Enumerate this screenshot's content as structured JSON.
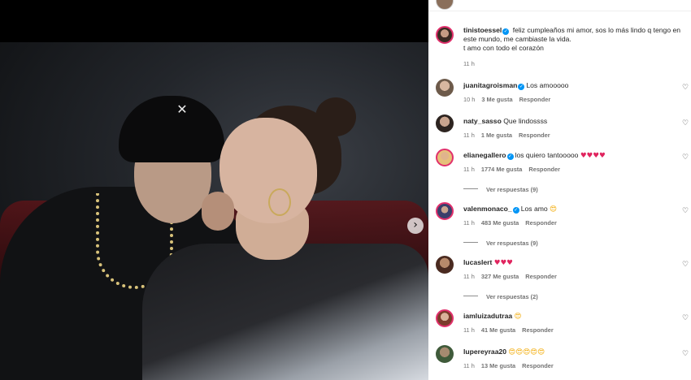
{
  "post": {
    "author": "tinistoessel",
    "caption_line1": "feliz cumpleaños mi amor, sos lo más lindo q tengo en este mundo, me cambiaste la vida.",
    "caption_line2": "t amo con todo el corazón",
    "time": "11 h"
  },
  "navigation": {
    "next_icon": "chevron-right-icon",
    "next_glyph": "›"
  },
  "icons": {
    "heart_glyph": "♡",
    "verified_glyph": "✓"
  },
  "colors": {
    "verified": "#0095f6",
    "panel_bg": "#ffffff",
    "text": "#262626",
    "muted": "#737373"
  },
  "comments": [
    {
      "user": "juanitagroisman",
      "verified": true,
      "text": "Los amooooo",
      "emoji": "",
      "time": "10 h",
      "likes": "3 Me gusta",
      "reply": "Responder",
      "replies": ""
    },
    {
      "user": "naty_sasso",
      "verified": false,
      "text": "Que lindossss",
      "emoji": "",
      "time": "11 h",
      "likes": "1 Me gusta",
      "reply": "Responder",
      "replies": ""
    },
    {
      "user": "elianegallero",
      "verified": true,
      "text": "los quiero tantooooo",
      "emoji": "♥♥♥♥",
      "time": "11 h",
      "likes": "1774 Me gusta",
      "reply": "Responder",
      "replies": "Ver respuestas (9)"
    },
    {
      "user": "valenmonaco_",
      "verified": true,
      "text": "Los amo",
      "emoji": "😍",
      "time": "11 h",
      "likes": "483 Me gusta",
      "reply": "Responder",
      "replies": "Ver respuestas (9)"
    },
    {
      "user": "lucaslert",
      "verified": false,
      "text": "",
      "emoji": "♥♥♥",
      "time": "11 h",
      "likes": "327 Me gusta",
      "reply": "Responder",
      "replies": "Ver respuestas (2)"
    },
    {
      "user": "iamluizadutraa",
      "verified": false,
      "text": "",
      "emoji": "😍",
      "time": "11 h",
      "likes": "41 Me gusta",
      "reply": "Responder",
      "replies": ""
    },
    {
      "user": "lupereyraa20",
      "verified": false,
      "text": "",
      "emoji": "😍😍😍😍😍",
      "time": "11 h",
      "likes": "13 Me gusta",
      "reply": "Responder",
      "replies": ""
    }
  ]
}
